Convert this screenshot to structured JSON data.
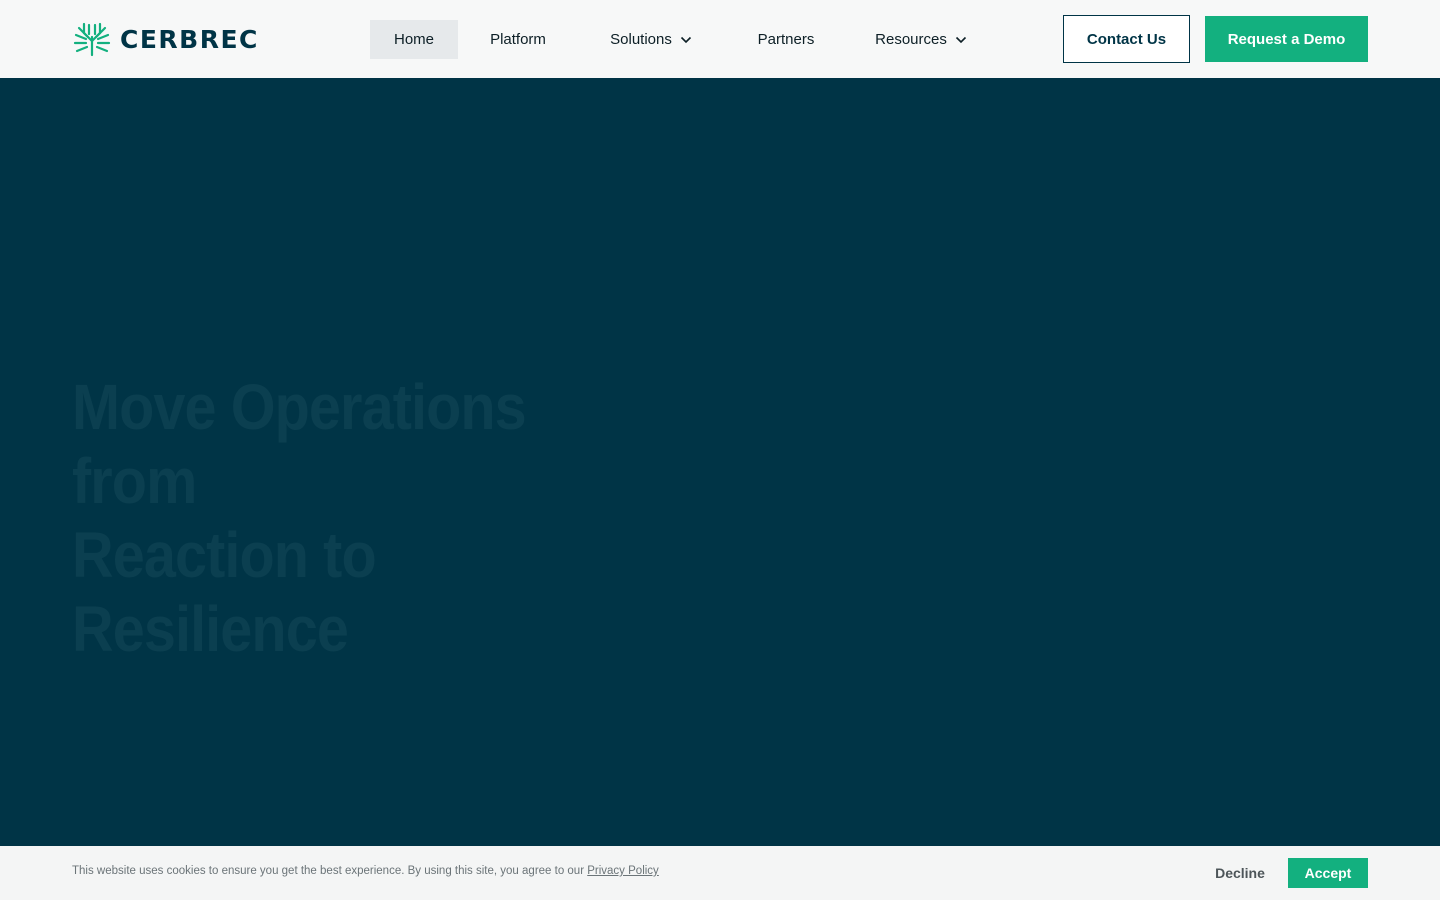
{
  "brand": {
    "name": "CERBREC",
    "logo_icon": "cerbrec-tree-icon",
    "color": "#003446",
    "accent": "#13b07f"
  },
  "nav": {
    "items": [
      {
        "label": "Home",
        "active": true,
        "has_dropdown": false
      },
      {
        "label": "Platform",
        "active": false,
        "has_dropdown": false
      },
      {
        "label": "Solutions",
        "active": false,
        "has_dropdown": true
      },
      {
        "label": "Partners",
        "active": false,
        "has_dropdown": false
      },
      {
        "label": "Resources",
        "active": false,
        "has_dropdown": true
      }
    ],
    "contact_label": "Contact Us",
    "demo_label": "Request a Demo"
  },
  "hero": {
    "title_line1": "Move Operations from",
    "title_line2": "Reaction to Resilience",
    "background": "#003446"
  },
  "cookie": {
    "text": "This website uses cookies to ensure you get the best experience. By using this site, you agree to our ",
    "link_label": "Privacy Policy",
    "decline_label": "Decline",
    "accept_label": "Accept"
  }
}
